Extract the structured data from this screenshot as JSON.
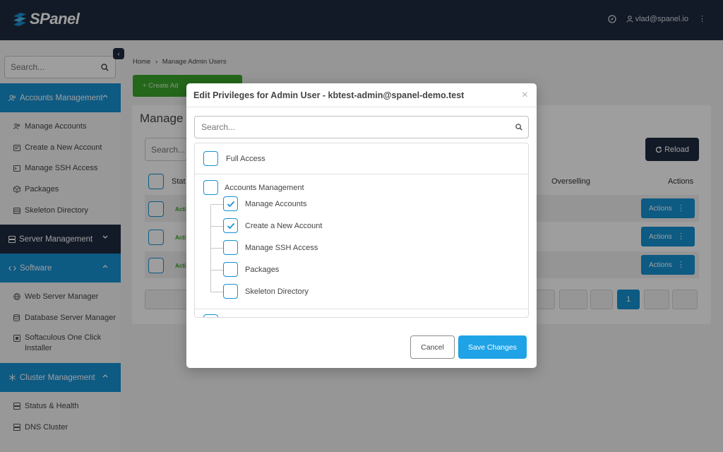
{
  "app": {
    "logo_text": "SPanel",
    "user_email": "vlad@spanel.io"
  },
  "sidebar": {
    "search_placeholder": "Search...",
    "sections": [
      {
        "label": "Accounts Management",
        "items": [
          "Manage Accounts",
          "Create a New Account",
          "Manage SSH Access",
          "Packages",
          "Skeleton Directory"
        ]
      },
      {
        "label": "Server Management"
      },
      {
        "label": "Software",
        "items": [
          "Web Server Manager",
          "Database Server Manager",
          "Softaculous One Click Installer"
        ]
      },
      {
        "label": "Cluster Management",
        "items": [
          "Status & Health",
          "DNS Cluster"
        ]
      }
    ]
  },
  "page": {
    "breadcrumb_home": "Home",
    "breadcrumb_sep": "›",
    "breadcrumb_current": "Manage Admin Users",
    "create_button": "+ Create Ad",
    "title": "Manage",
    "search_placeholder": "Search...",
    "reload_button": "Reload",
    "columns": {
      "status": "Stat",
      "overselling": "Overselling",
      "actions": "Actions"
    },
    "rows": [
      {
        "status": "Acti",
        "action": "Actions"
      },
      {
        "status": "Acti",
        "action": "Actions"
      },
      {
        "status": "Acti",
        "action": "Actions"
      }
    ],
    "current_page": "1"
  },
  "modal": {
    "title": "Edit Privileges for Admin User - kbtest-admin@spanel-demo.test",
    "search_placeholder": "Search...",
    "full_access": "Full Access",
    "group_label": "Accounts Management",
    "children": [
      {
        "label": "Manage Accounts",
        "checked": true
      },
      {
        "label": "Create a New Account",
        "checked": true
      },
      {
        "label": "Manage SSH Access",
        "checked": false
      },
      {
        "label": "Packages",
        "checked": false
      },
      {
        "label": "Skeleton Directory",
        "checked": false
      }
    ],
    "cancel_button": "Cancel",
    "save_button": "Save Changes"
  },
  "colors": {
    "brand_dark": "#1f2b3f",
    "accent_blue": "#1692d3",
    "green": "#3ba62a"
  }
}
